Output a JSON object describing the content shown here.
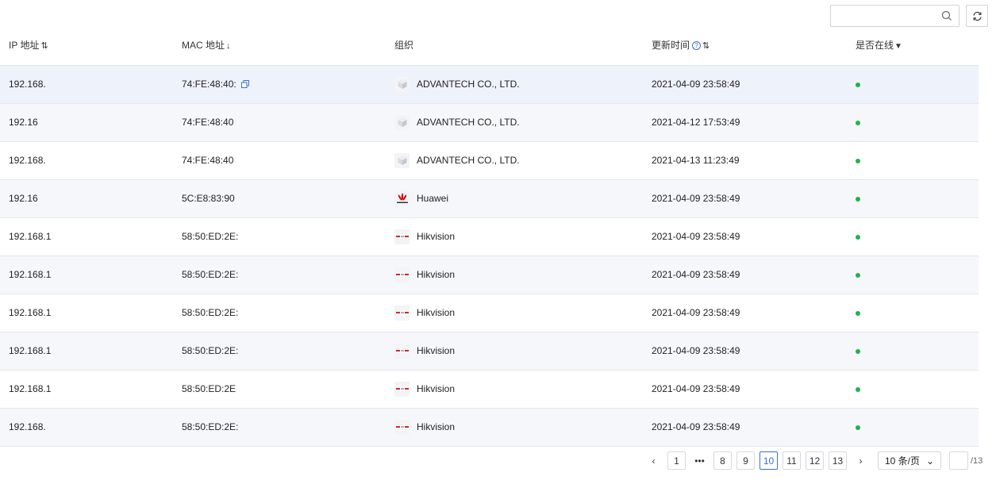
{
  "toolbar": {
    "search_placeholder": "",
    "search_icon": "search-icon",
    "refresh_icon": "refresh-icon"
  },
  "table": {
    "columns": {
      "ip": "IP 地址",
      "mac": "MAC 地址",
      "org": "组织",
      "time": "更新时间",
      "online": "是否在线"
    },
    "rows": [
      {
        "ip": "192.168.",
        "mac": "74:FE:48:40:",
        "org": "ADVANTECH CO., LTD.",
        "logo": "cube-icon",
        "time": "2021-04-09 23:58:49",
        "online": true
      },
      {
        "ip": "192.16",
        "mac": "74:FE:48:40",
        "org": "ADVANTECH CO., LTD.",
        "logo": "cube-icon",
        "time": "2021-04-12 17:53:49",
        "online": true
      },
      {
        "ip": "192.168.",
        "mac": "74:FE:48:40",
        "org": "ADVANTECH CO., LTD.",
        "logo": "cube-icon",
        "time": "2021-04-13 11:23:49",
        "online": true
      },
      {
        "ip": "192.16",
        "mac": "5C:E8:83:90",
        "org": "Huawei",
        "logo": "huawei-logo-icon",
        "time": "2021-04-09 23:58:49",
        "online": true
      },
      {
        "ip": "192.168.1",
        "mac": "58:50:ED:2E:",
        "org": "Hikvision",
        "logo": "hikvision-logo-icon",
        "time": "2021-04-09 23:58:49",
        "online": true
      },
      {
        "ip": "192.168.1",
        "mac": "58:50:ED:2E:",
        "org": "Hikvision",
        "logo": "hikvision-logo-icon",
        "time": "2021-04-09 23:58:49",
        "online": true
      },
      {
        "ip": "192.168.1",
        "mac": "58:50:ED:2E:",
        "org": "Hikvision",
        "logo": "hikvision-logo-icon",
        "time": "2021-04-09 23:58:49",
        "online": true
      },
      {
        "ip": "192.168.1",
        "mac": "58:50:ED:2E:",
        "org": "Hikvision",
        "logo": "hikvision-logo-icon",
        "time": "2021-04-09 23:58:49",
        "online": true
      },
      {
        "ip": "192.168.1",
        "mac": "58:50:ED:2E",
        "org": "Hikvision",
        "logo": "hikvision-logo-icon",
        "time": "2021-04-09 23:58:49",
        "online": true
      },
      {
        "ip": "192.168.",
        "mac": "58:50:ED:2E:",
        "org": "Hikvision",
        "logo": "hikvision-logo-icon",
        "time": "2021-04-09 23:58:49",
        "online": true
      }
    ]
  },
  "pager": {
    "pages": [
      "1",
      "8",
      "9",
      "10",
      "11",
      "12",
      "13"
    ],
    "current": "10",
    "ellipsis": "•••",
    "page_size": "10 条/页",
    "total": "/13"
  },
  "colors": {
    "accent": "#3a6fd8",
    "online": "#22b14c",
    "huawei": "#d7000f",
    "hikvision": "#d2282d"
  }
}
